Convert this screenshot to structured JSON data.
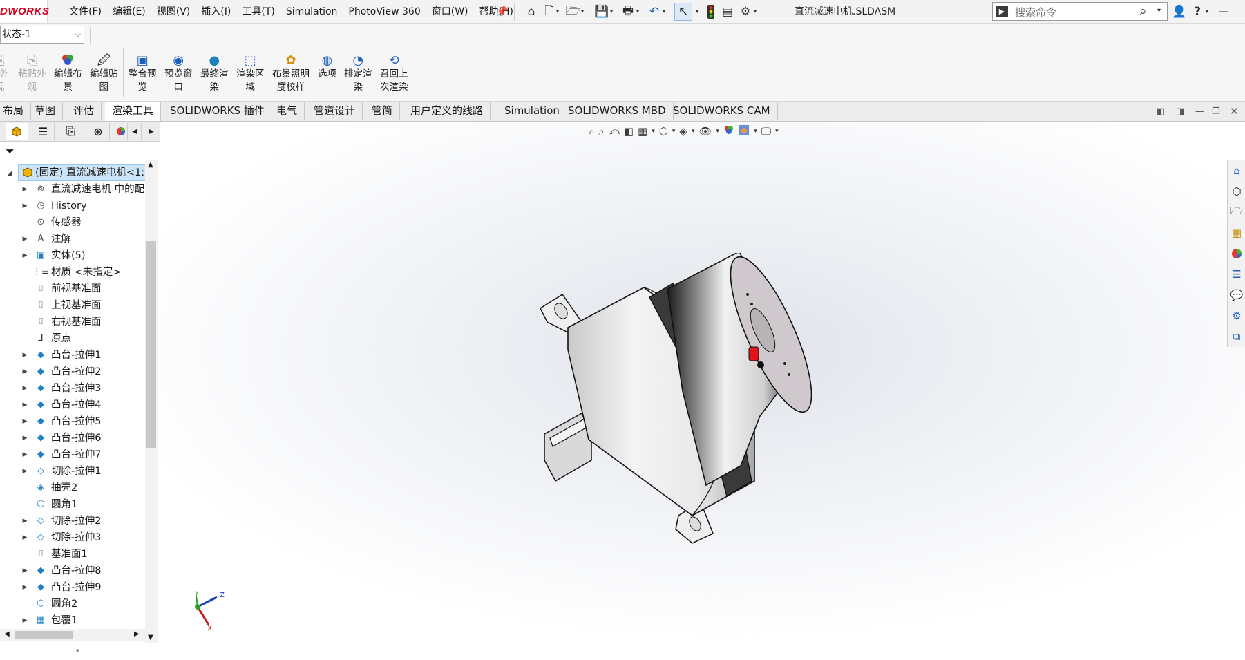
{
  "app": {
    "logo_text": "DWORKS",
    "document_title": "直流减速电机.SLDASM"
  },
  "menu": [
    "文件(F)",
    "编辑(E)",
    "视图(V)",
    "插入(I)",
    "工具(T)",
    "Simulation",
    "PhotoView 360",
    "窗口(W)",
    "帮助(H)"
  ],
  "search": {
    "placeholder": "搜索命令"
  },
  "config": {
    "value": "状态-1"
  },
  "ribbon": [
    {
      "label1": "剖外",
      "label2": "观",
      "icon": "paste-appearance-icon",
      "disabled": true
    },
    {
      "label1": "粘贴外",
      "label2": "观",
      "icon": "paste-appearance-icon",
      "disabled": true
    },
    {
      "label1": "编辑布",
      "label2": "景",
      "icon": "edit-scene-icon",
      "disabled": false
    },
    {
      "label1": "编辑贴",
      "label2": "图",
      "icon": "edit-decal-icon",
      "disabled": false
    },
    {
      "label1": "整合预",
      "label2": "览",
      "icon": "integrated-preview-icon",
      "disabled": false
    },
    {
      "label1": "预览窗",
      "label2": "口",
      "icon": "preview-window-icon",
      "disabled": false
    },
    {
      "label1": "最终渲",
      "label2": "染",
      "icon": "final-render-icon",
      "disabled": false
    },
    {
      "label1": "渲染区",
      "label2": "域",
      "icon": "render-region-icon",
      "disabled": false
    },
    {
      "label1": "布景照明",
      "label2": "度校样",
      "icon": "scene-illumination-icon",
      "disabled": false
    },
    {
      "label1": "选项",
      "label2": "",
      "icon": "options-icon",
      "disabled": false
    },
    {
      "label1": "排定渲",
      "label2": "染",
      "icon": "schedule-render-icon",
      "disabled": false
    },
    {
      "label1": "召回上",
      "label2": "次渲染",
      "icon": "recall-last-render-icon",
      "disabled": false
    }
  ],
  "tabs": [
    "布局",
    "草图",
    "评估",
    "渲染工具",
    "SOLIDWORKS 插件",
    "电气",
    "管道设计",
    "管筒",
    "用户定义的线路",
    "Simulation",
    "SOLIDWORKS MBD",
    "SOLIDWORKS CAM"
  ],
  "active_tab": "渲染工具",
  "tree": {
    "root": "(固定) 直流减速电机<1:",
    "items": [
      {
        "label": "直流减速电机 中的配",
        "icon": "folder-mates-icon",
        "expandable": true
      },
      {
        "label": "History",
        "icon": "history-icon",
        "expandable": true
      },
      {
        "label": "传感器",
        "icon": "sensor-icon",
        "expandable": false
      },
      {
        "label": "注解",
        "icon": "annotation-icon",
        "expandable": true
      },
      {
        "label": "实体(5)",
        "icon": "solid-bodies-icon",
        "expandable": true
      },
      {
        "label": "材质 <未指定>",
        "icon": "material-icon",
        "expandable": false
      },
      {
        "label": "前视基准面",
        "icon": "plane-icon",
        "expandable": false
      },
      {
        "label": "上视基准面",
        "icon": "plane-icon",
        "expandable": false
      },
      {
        "label": "右视基准面",
        "icon": "plane-icon",
        "expandable": false
      },
      {
        "label": "原点",
        "icon": "origin-icon",
        "expandable": false
      },
      {
        "label": "凸台-拉伸1",
        "icon": "extrude-icon",
        "expandable": true
      },
      {
        "label": "凸台-拉伸2",
        "icon": "extrude-icon",
        "expandable": true
      },
      {
        "label": "凸台-拉伸3",
        "icon": "extrude-icon",
        "expandable": true
      },
      {
        "label": "凸台-拉伸4",
        "icon": "extrude-icon",
        "expandable": true
      },
      {
        "label": "凸台-拉伸5",
        "icon": "extrude-icon",
        "expandable": true
      },
      {
        "label": "凸台-拉伸6",
        "icon": "extrude-icon",
        "expandable": true
      },
      {
        "label": "凸台-拉伸7",
        "icon": "extrude-icon",
        "expandable": true
      },
      {
        "label": "切除-拉伸1",
        "icon": "cut-extrude-icon",
        "expandable": true
      },
      {
        "label": "抽壳2",
        "icon": "shell-icon",
        "expandable": false
      },
      {
        "label": "圆角1",
        "icon": "fillet-icon",
        "expandable": false
      },
      {
        "label": "切除-拉伸2",
        "icon": "cut-extrude-icon",
        "expandable": true
      },
      {
        "label": "切除-拉伸3",
        "icon": "cut-extrude-icon",
        "expandable": true
      },
      {
        "label": "基准面1",
        "icon": "plane-icon",
        "expandable": false
      },
      {
        "label": "凸台-拉伸8",
        "icon": "extrude-icon",
        "expandable": true
      },
      {
        "label": "凸台-拉伸9",
        "icon": "extrude-icon",
        "expandable": true
      },
      {
        "label": "圆角2",
        "icon": "fillet-icon",
        "expandable": false
      },
      {
        "label": "包覆1",
        "icon": "wrap-icon",
        "expandable": true
      }
    ]
  },
  "triad": {
    "x": "X",
    "y": "Y",
    "z": "Z"
  },
  "colors": {
    "logo_red": "#d6001c",
    "selection_blue": "#cce4f7",
    "accent_red": "#e0161b"
  }
}
